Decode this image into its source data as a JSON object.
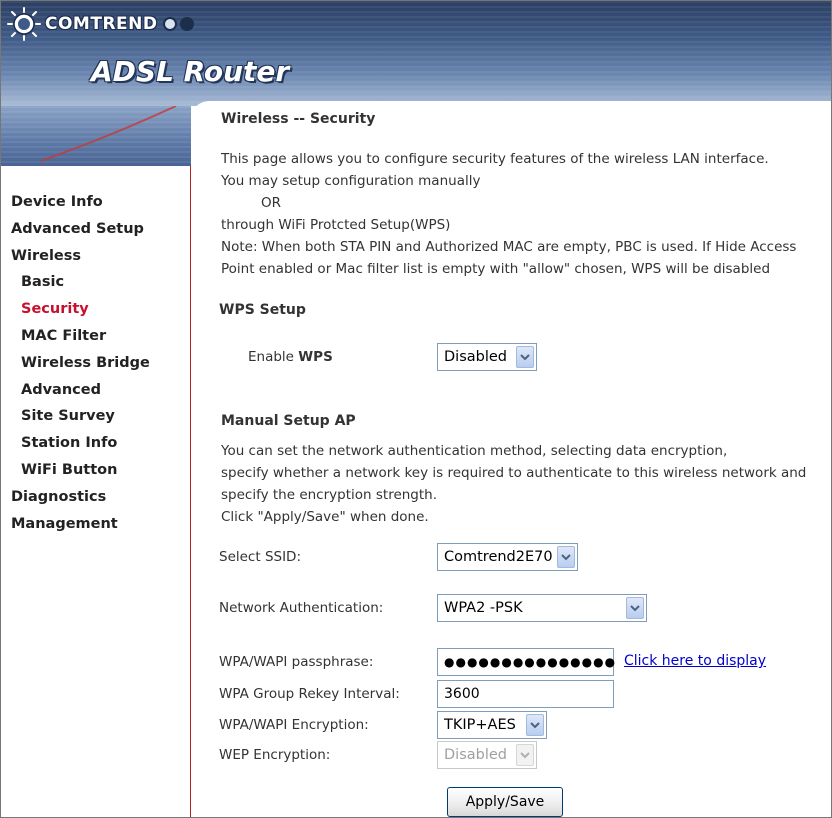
{
  "header": {
    "brand": "COMTREND",
    "product": "ADSL Router"
  },
  "nav": {
    "items": [
      {
        "label": "Device Info"
      },
      {
        "label": "Advanced Setup"
      },
      {
        "label": "Wireless"
      },
      {
        "label": "Basic"
      },
      {
        "label": "Security"
      },
      {
        "label": "MAC Filter"
      },
      {
        "label": "Wireless Bridge"
      },
      {
        "label": "Advanced"
      },
      {
        "label": "Site Survey"
      },
      {
        "label": "Station Info"
      },
      {
        "label": "WiFi Button"
      },
      {
        "label": "Diagnostics"
      },
      {
        "label": "Management"
      }
    ]
  },
  "page": {
    "title": "Wireless -- Security",
    "intro": [
      "This page allows you to configure security features of the wireless LAN interface.",
      "You may setup configuration manually",
      "OR",
      "through WiFi Protcted Setup(WPS)",
      "Note: When both STA PIN and Authorized MAC are empty, PBC is used. If Hide Access",
      "Point enabled or Mac filter list is empty with \"allow\" chosen, WPS will be disabled"
    ]
  },
  "wps": {
    "section_title": "WPS Setup",
    "enable_label_prefix": "Enable ",
    "enable_label_bold": "WPS",
    "enable_value": "Disabled"
  },
  "manual": {
    "section_title": "Manual Setup AP",
    "desc": [
      "You can set the network authentication method, selecting data encryption,",
      "specify whether a network key is required to authenticate to this wireless network and",
      "specify the encryption strength.",
      "Click \"Apply/Save\" when done."
    ],
    "ssid_label": "Select SSID:",
    "ssid_value": "Comtrend2E70",
    "auth_label": "Network Authentication:",
    "auth_value": "WPA2 -PSK",
    "passphrase_label": "WPA/WAPI passphrase:",
    "passphrase_value": "●●●●●●●●●●●●●●●",
    "display_link": "Click here to display",
    "rekey_label": "WPA Group Rekey Interval:",
    "rekey_value": "3600",
    "encryption_label": "WPA/WAPI Encryption:",
    "encryption_value": "TKIP+AES",
    "wep_label": "WEP Encryption:",
    "wep_value": "Disabled",
    "apply_label": "Apply/Save"
  }
}
